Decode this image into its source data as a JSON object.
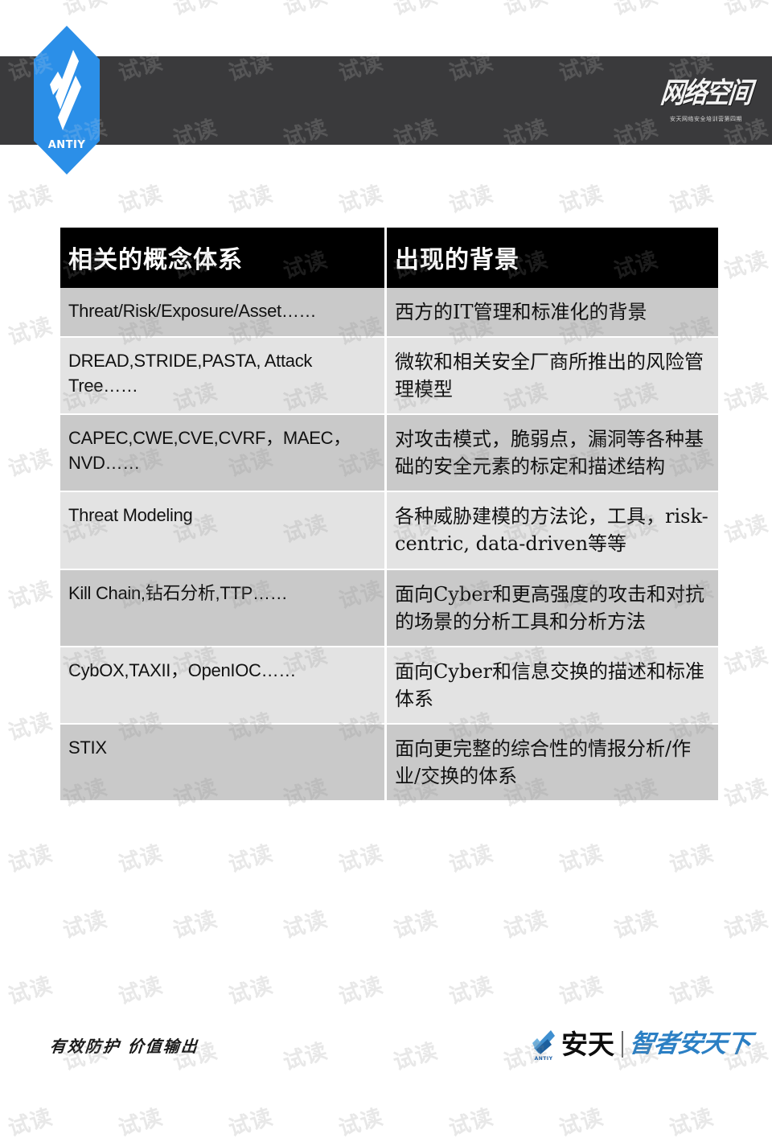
{
  "header": {
    "logo_text": "ANTIY",
    "calligraphy_main": "网络空间",
    "calligraphy_sub": "安天网络安全培训营第四期"
  },
  "table": {
    "columns": [
      "相关的概念体系",
      "出现的背景"
    ],
    "rows": [
      {
        "concept": "Threat/Risk/Exposure/Asset……",
        "background": "西方的IT管理和标准化的背景"
      },
      {
        "concept": "DREAD,STRIDE,PASTA, Attack Tree……",
        "background": "微软和相关安全厂商所推出的风险管理模型"
      },
      {
        "concept": "CAPEC,CWE,CVE,CVRF，MAEC，NVD……",
        "background": "对攻击模式，脆弱点，漏洞等各种基础的安全元素的标定和描述结构"
      },
      {
        "concept": "Threat Modeling",
        "background": "各种威胁建模的方法论，工具，risk-centric, data-driven等等"
      },
      {
        "concept": "Kill Chain,钻石分析,TTP……",
        "background": "面向Cyber和更高强度的攻击和对抗的场景的分析工具和分析方法"
      },
      {
        "concept": "CybOX,TAXII，OpenIOC……",
        "background": "面向Cyber和信息交换的描述和标准体系"
      },
      {
        "concept": "STIX",
        "background": "面向更完整的综合性的情报分析/作业/交换的体系"
      }
    ]
  },
  "footer": {
    "slogan": "有效防护 价值输出",
    "logo_mark_label": "ANTIY",
    "logo_name": "安天",
    "logo_tagline": "智者安天下"
  },
  "watermark": {
    "text": "试读"
  },
  "colors": {
    "banner": "#3a3a3c",
    "brand_blue": "#2b8fe8",
    "header_row": "#000000",
    "row_dark": "#c9c9c9",
    "row_light": "#e3e3e3",
    "tagline_blue": "#2b7fc4"
  }
}
